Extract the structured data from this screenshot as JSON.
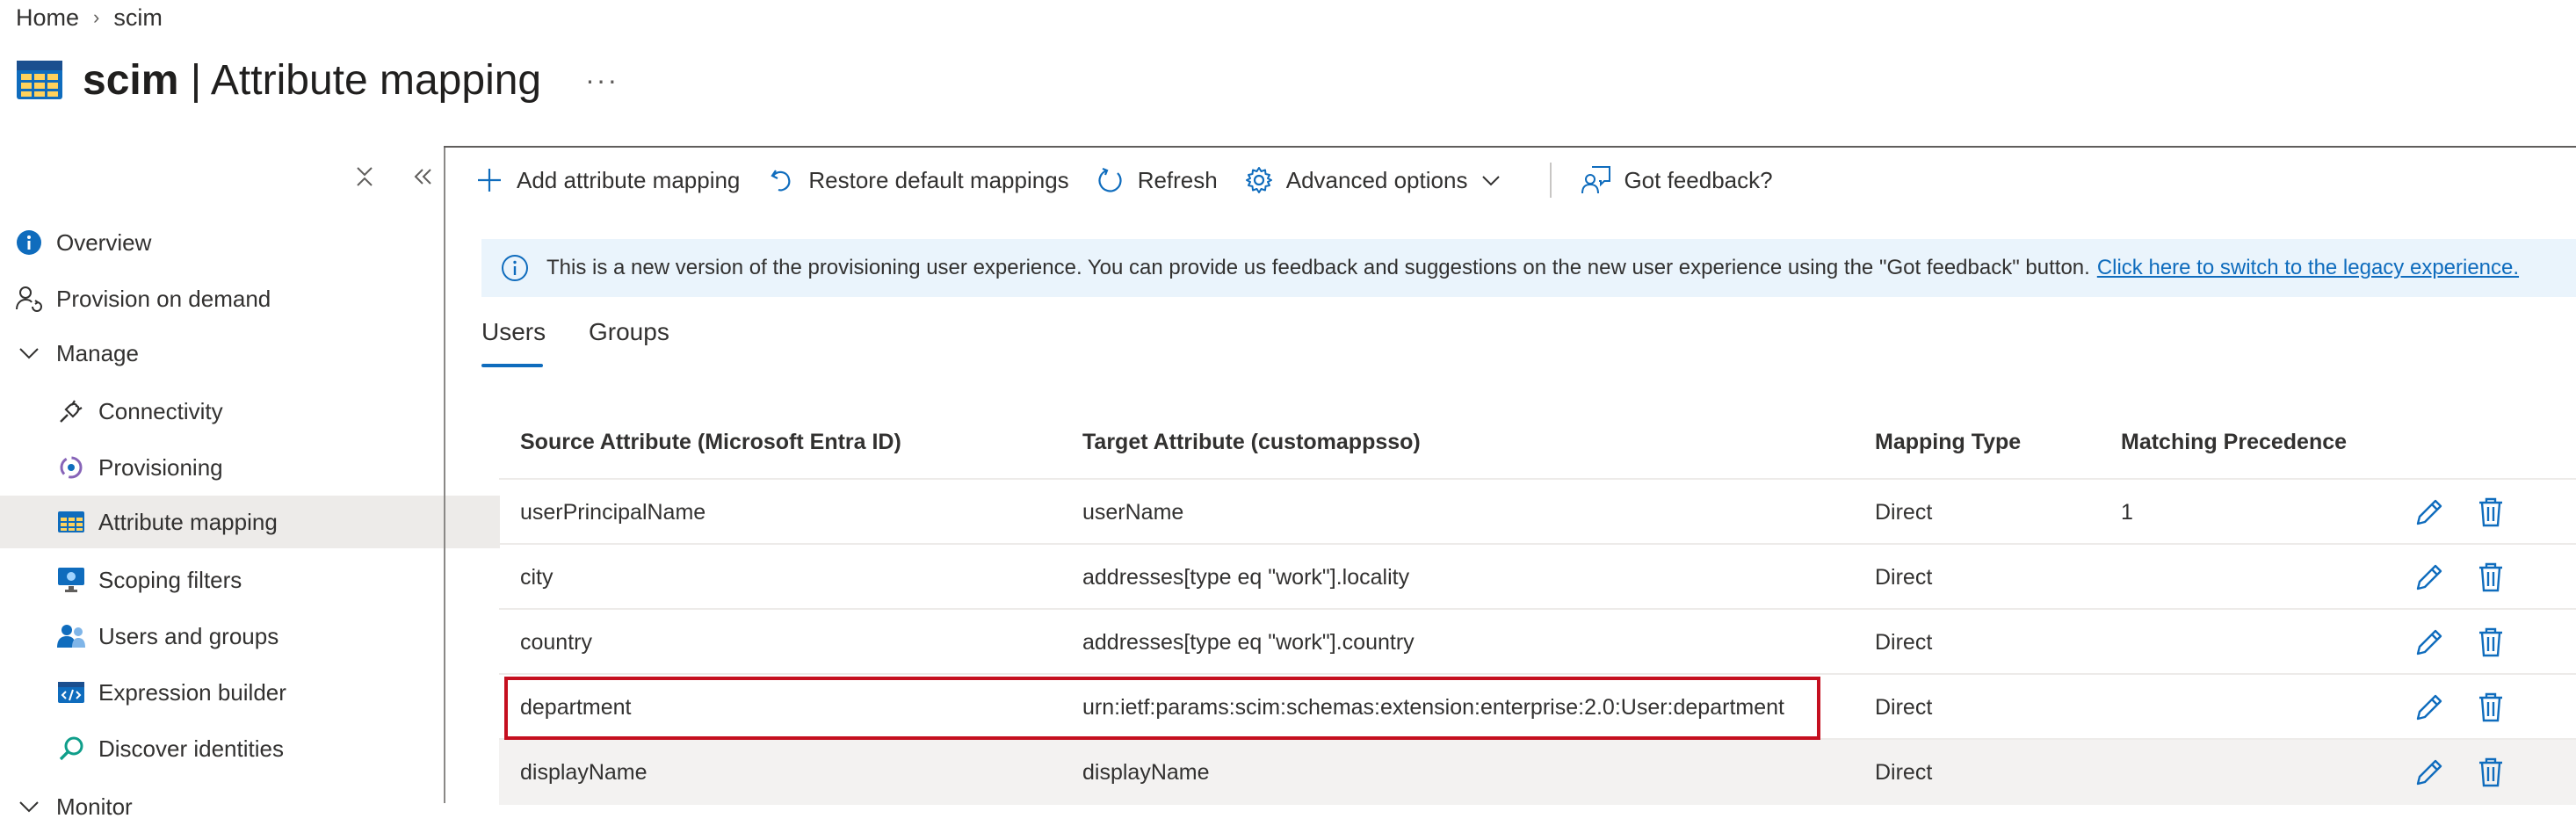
{
  "breadcrumb": {
    "home": "Home",
    "separator": "›",
    "current": "scim"
  },
  "header": {
    "app_name": "scim",
    "separator": " | ",
    "page_title": "Attribute mapping",
    "more": "···"
  },
  "sidebar": {
    "collapse_all": "⌅",
    "collapse_panel": "«",
    "items": [
      {
        "label": "Overview",
        "icon": "info-icon"
      },
      {
        "label": "Provision on demand",
        "icon": "person-sync-icon"
      },
      {
        "label": "Manage",
        "icon": "chevron-down-icon"
      },
      {
        "label": "Connectivity",
        "icon": "plug-icon"
      },
      {
        "label": "Provisioning",
        "icon": "provisioning-icon"
      },
      {
        "label": "Attribute mapping",
        "icon": "table-icon",
        "selected": true
      },
      {
        "label": "Scoping filters",
        "icon": "monitor-icon"
      },
      {
        "label": "Users and groups",
        "icon": "people-icon"
      },
      {
        "label": "Expression builder",
        "icon": "code-icon"
      },
      {
        "label": "Discover identities",
        "icon": "search-icon"
      },
      {
        "label": "Monitor",
        "icon": "chevron-down-icon"
      }
    ]
  },
  "toolbar": {
    "add": "Add attribute mapping",
    "restore": "Restore default mappings",
    "refresh": "Refresh",
    "advanced": "Advanced options",
    "feedback": "Got feedback?"
  },
  "banner": {
    "text": "This is a new version of the provisioning user experience. You can provide us feedback and suggestions on the new user experience using the \"Got feedback\" button.",
    "link": "Click here to switch to the legacy experience."
  },
  "tabs": [
    {
      "label": "Users",
      "active": true
    },
    {
      "label": "Groups",
      "active": false
    }
  ],
  "table": {
    "headers": {
      "source": "Source Attribute (Microsoft Entra ID)",
      "target": "Target Attribute (customappsso)",
      "type": "Mapping Type",
      "precedence": "Matching Precedence"
    },
    "rows": [
      {
        "source": "userPrincipalName",
        "target": "userName",
        "type": "Direct",
        "precedence": "1"
      },
      {
        "source": "city",
        "target": "addresses[type eq \"work\"].locality",
        "type": "Direct",
        "precedence": ""
      },
      {
        "source": "country",
        "target": "addresses[type eq \"work\"].country",
        "type": "Direct",
        "precedence": ""
      },
      {
        "source": "department",
        "target": "urn:ietf:params:scim:schemas:extension:enterprise:2.0:User:department",
        "type": "Direct",
        "precedence": ""
      },
      {
        "source": "displayName",
        "target": "displayName",
        "type": "Direct",
        "precedence": ""
      }
    ]
  },
  "colors": {
    "accent": "#0f6cbd",
    "highlight": "#c50f1f",
    "selected_bg": "#edebe9",
    "banner_bg": "#eaf4fc"
  }
}
